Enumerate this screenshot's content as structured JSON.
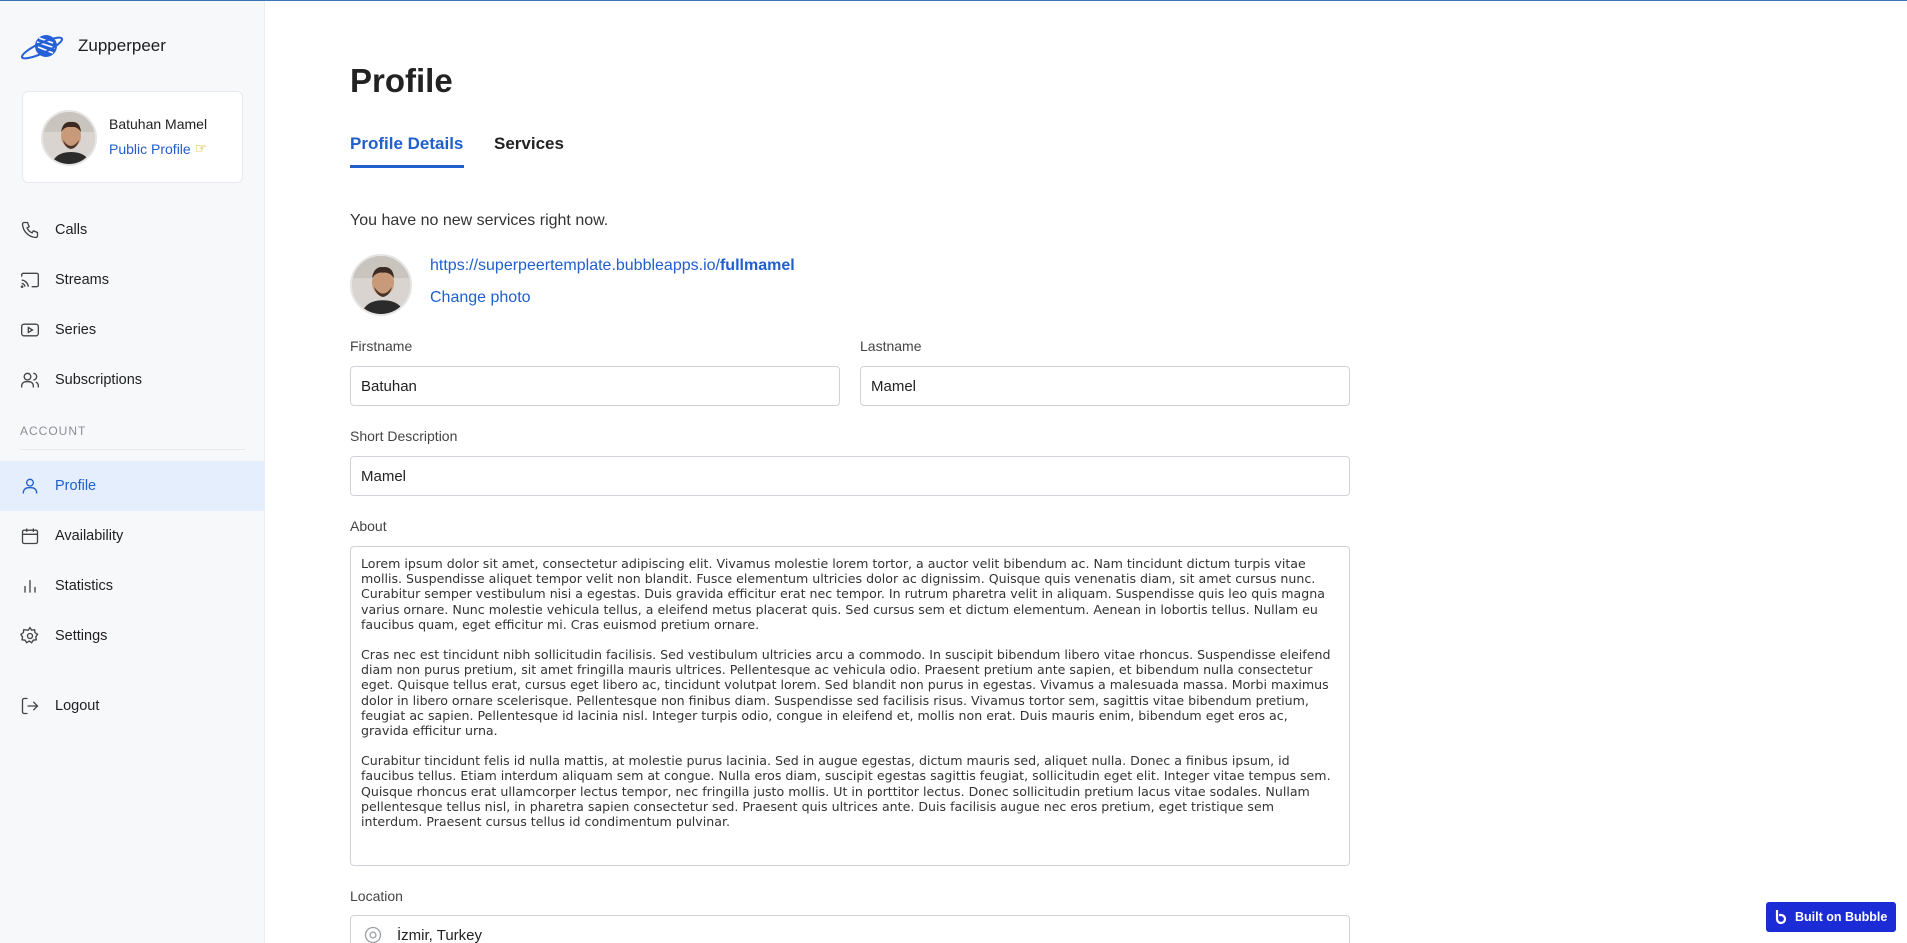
{
  "brand": {
    "name": "Zupperpeer"
  },
  "user": {
    "name": "Batuhan Mamel",
    "public_profile_label": "Public Profile"
  },
  "nav": {
    "items": [
      {
        "label": "Calls",
        "icon": "phone-icon"
      },
      {
        "label": "Streams",
        "icon": "cast-icon"
      },
      {
        "label": "Series",
        "icon": "play-icon"
      },
      {
        "label": "Subscriptions",
        "icon": "users-icon"
      }
    ],
    "account_label": "ACCOUNT",
    "account_items": [
      {
        "label": "Profile",
        "icon": "user-icon",
        "active": true
      },
      {
        "label": "Availability",
        "icon": "calendar-icon"
      },
      {
        "label": "Statistics",
        "icon": "bar-chart-icon"
      },
      {
        "label": "Settings",
        "icon": "gear-icon"
      }
    ],
    "logout_label": "Logout"
  },
  "main": {
    "title": "Profile",
    "tabs": [
      {
        "label": "Profile Details",
        "active": true
      },
      {
        "label": "Services"
      }
    ],
    "no_services_text": "You have no new services right now.",
    "profile_url_base": "https://superpeertemplate.bubbleapps.io/",
    "profile_url_slug": "fullmamel",
    "change_photo_label": "Change photo",
    "form": {
      "firstname_label": "Firstname",
      "firstname_value": "Batuhan",
      "lastname_label": "Lastname",
      "lastname_value": "Mamel",
      "short_description_label": "Short Description",
      "short_description_value": "Mamel",
      "about_label": "About",
      "about_paragraphs": [
        "Lorem ipsum dolor sit amet, consectetur adipiscing elit. Vivamus molestie lorem tortor, a auctor velit bibendum ac. Nam tincidunt dictum turpis vitae mollis. Suspendisse aliquet tempor velit non blandit. Fusce elementum ultricies dolor ac dignissim. Quisque quis venenatis diam, sit amet cursus nunc. Curabitur semper vestibulum nisi a egestas. Duis gravida efficitur erat nec tempor. In rutrum pharetra velit in aliquam. Suspendisse quis leo quis magna varius ornare. Nunc molestie vehicula tellus, a eleifend metus placerat quis. Sed cursus sem et dictum elementum. Aenean in lobortis tellus. Nullam eu faucibus quam, eget efficitur mi. Cras euismod pretium ornare.",
        "Cras nec est tincidunt nibh sollicitudin facilisis. Sed vestibulum ultricies arcu a commodo. In suscipit bibendum libero vitae rhoncus. Suspendisse eleifend diam non purus pretium, sit amet fringilla mauris ultrices. Pellentesque ac vehicula odio. Praesent pretium ante sapien, et bibendum nulla consectetur eget. Quisque tellus erat, cursus eget libero ac, tincidunt volutpat lorem. Sed blandit non purus in egestas. Vivamus a malesuada massa. Morbi maximus dolor in libero ornare scelerisque. Pellentesque non finibus diam. Suspendisse sed facilisis risus. Vivamus tortor sem, sagittis vitae bibendum pretium, feugiat ac sapien. Pellentesque id lacinia nisl. Integer turpis odio, congue in eleifend et, mollis non erat. Duis mauris enim, bibendum eget eros ac, gravida efficitur urna.",
        "Curabitur tincidunt felis id nulla mattis, at molestie purus lacinia. Sed in augue egestas, dictum mauris sed, aliquet nulla. Donec a finibus ipsum, id faucibus tellus. Etiam interdum aliquam sem at congue. Nulla eros diam, suscipit egestas sagittis feugiat, sollicitudin eget elit. Integer vitae tempus sem. Quisque rhoncus erat ullamcorper lectus tempor, nec fringilla justo mollis. Ut in porttitor lectus. Donec sollicitudin pretium lacus vitae sodales. Nullam pellentesque tellus nisl, in pharetra sapien consectetur sed. Praesent quis ultrices ante. Duis facilisis augue nec eros pretium, eget tristique sem interdum. Praesent cursus tellus id condimentum pulvinar."
      ],
      "location_label": "Location",
      "location_value": "İzmir, Turkey"
    }
  },
  "badge": {
    "label": "Built on Bubble"
  },
  "colors": {
    "accent": "#1f5fce",
    "active_bg": "#e4eefc",
    "sidebar_bg": "#f7f8fa",
    "badge_bg": "#1b2bd6"
  }
}
